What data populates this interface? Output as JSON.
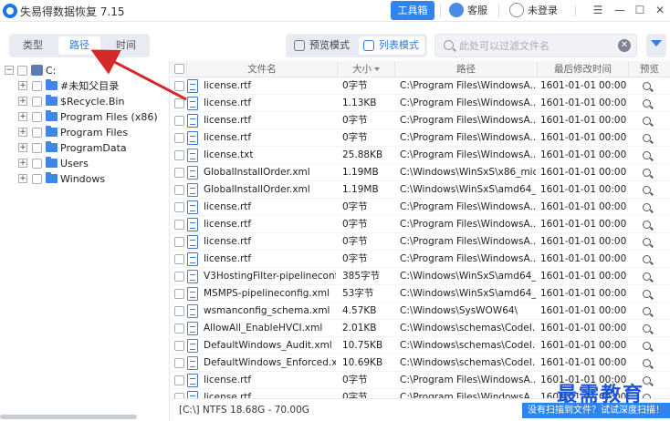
{
  "app": {
    "title": "失易得数据恢复 7.15",
    "toolbox_label": "工具箱",
    "service_label": "客服",
    "login_label": "未登录"
  },
  "mode_tabs": [
    "类型",
    "路径",
    "时间"
  ],
  "active_mode_tab": "路径",
  "view_modes": {
    "preview": "预览模式",
    "list": "列表模式",
    "active": "列表模式"
  },
  "search": {
    "placeholder": "此处可以过滤文件名",
    "value": ""
  },
  "tree": {
    "root": "C:",
    "children": [
      "#未知父目录",
      "$Recycle.Bin",
      "Program Files (x86)",
      "Program Files",
      "ProgramData",
      "Users",
      "Windows"
    ]
  },
  "table": {
    "headers": {
      "name": "文件名",
      "size": "大小",
      "path": "路径",
      "modified": "最后修改时间",
      "preview": "预览"
    },
    "rows": [
      {
        "icon": "rtf",
        "name": "license.rtf",
        "size": "0字节",
        "path": "C:\\Program Files\\WindowsA...",
        "date": "1601-01-01",
        "time": "00:00"
      },
      {
        "icon": "rtf",
        "name": "license.rtf",
        "size": "1.13KB",
        "path": "C:\\Program Files\\WindowsA...",
        "date": "1601-01-01",
        "time": "00:00"
      },
      {
        "icon": "rtf",
        "name": "license.rtf",
        "size": "0字节",
        "path": "C:\\Program Files\\WindowsA...",
        "date": "1601-01-01",
        "time": "00:00"
      },
      {
        "icon": "rtf",
        "name": "license.rtf",
        "size": "0字节",
        "path": "C:\\Program Files\\WindowsA...",
        "date": "1601-01-01",
        "time": "00:00"
      },
      {
        "icon": "txt",
        "name": "license.txt",
        "size": "25.88KB",
        "path": "C:\\Program Files\\WindowsA...",
        "date": "1601-01-01",
        "time": "00:00"
      },
      {
        "icon": "xml",
        "name": "GlobalInstallOrder.xml",
        "size": "1.19MB",
        "path": "C:\\Windows\\WinSxS\\x86_mic...",
        "date": "1601-01-01",
        "time": "00:00"
      },
      {
        "icon": "xml",
        "name": "GlobalInstallOrder.xml",
        "size": "1.19MB",
        "path": "C:\\Windows\\WinSxS\\amd64_...",
        "date": "1601-01-01",
        "time": "00:00"
      },
      {
        "icon": "rtf",
        "name": "license.rtf",
        "size": "0字节",
        "path": "C:\\Program Files\\WindowsA...",
        "date": "1601-01-01",
        "time": "00:00"
      },
      {
        "icon": "rtf",
        "name": "license.rtf",
        "size": "0字节",
        "path": "C:\\Program Files\\WindowsA...",
        "date": "1601-01-01",
        "time": "00:00"
      },
      {
        "icon": "rtf",
        "name": "license.rtf",
        "size": "0字节",
        "path": "C:\\Program Files\\WindowsA...",
        "date": "1601-01-01",
        "time": "00:00"
      },
      {
        "icon": "rtf",
        "name": "license.rtf",
        "size": "0字节",
        "path": "C:\\Program Files\\WindowsA...",
        "date": "1601-01-01",
        "time": "00:00"
      },
      {
        "icon": "xml",
        "name": "V3HostingFilter-pipelineconf...",
        "size": "385字节",
        "path": "C:\\Windows\\WinSxS\\amd64_...",
        "date": "1601-01-01",
        "time": "00:00"
      },
      {
        "icon": "xml",
        "name": "MSMPS-pipelineconfig.xml",
        "size": "53字节",
        "path": "C:\\Windows\\WinSxS\\amd64_...",
        "date": "1601-01-01",
        "time": "00:00"
      },
      {
        "icon": "xml",
        "name": "wsmanconfig_schema.xml",
        "size": "4.57KB",
        "path": "C:\\Windows\\SysWOW64\\",
        "date": "1601-01-01",
        "time": "00:00"
      },
      {
        "icon": "xml",
        "name": "AllowAll_EnableHVCI.xml",
        "size": "2.01KB",
        "path": "C:\\Windows\\schemas\\CodeI...",
        "date": "1601-01-01",
        "time": "00:00"
      },
      {
        "icon": "xml",
        "name": "DefaultWindows_Audit.xml",
        "size": "10.75KB",
        "path": "C:\\Windows\\schemas\\CodeI...",
        "date": "1601-01-01",
        "time": "00:00"
      },
      {
        "icon": "xml",
        "name": "DefaultWindows_Enforced.x...",
        "size": "10.69KB",
        "path": "C:\\Windows\\schemas\\CodeI...",
        "date": "1601-01-01",
        "time": "00:00"
      },
      {
        "icon": "rtf",
        "name": "license.rtf",
        "size": "0字节",
        "path": "C:\\Program Files\\WindowsA...",
        "date": "1601-01-01",
        "time": "00:00"
      },
      {
        "icon": "rtf",
        "name": "license.rtf",
        "size": "0字节",
        "path": "C:\\Program Files\\WindowsA...",
        "date": "1601-01-01",
        "time": "00:00"
      }
    ]
  },
  "status": {
    "text": "[C:\\] NTFS 18.68G - 70.00G",
    "deep_scan_label": "没有扫描到文件？试试深度扫描！"
  },
  "watermark": "最需教育",
  "colors": {
    "accent": "#2f84ee",
    "folder": "#3f86e6",
    "annotation_arrow": "#d42a2a"
  }
}
